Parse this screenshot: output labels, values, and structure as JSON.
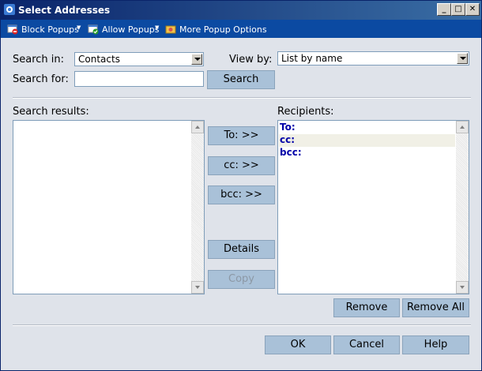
{
  "window": {
    "title": "Select Addresses",
    "minimize": "_",
    "maximize": "□",
    "close": "✕"
  },
  "toolbar": {
    "block_popups": "Block Popups",
    "allow_popups": "Allow Popups",
    "more_options": "More Popup Options"
  },
  "search": {
    "search_in_label": "Search in:",
    "search_in_value": "Contacts",
    "view_by_label": "View by:",
    "view_by_value": "List by name",
    "search_for_label": "Search for:",
    "search_for_value": "",
    "search_button": "Search"
  },
  "results": {
    "label": "Search results:"
  },
  "recipients": {
    "label": "Recipients:",
    "rows": [
      "To:",
      "cc:",
      "bcc:"
    ]
  },
  "middle_buttons": {
    "to": "To: >>",
    "cc": "cc: >>",
    "bcc": "bcc: >>",
    "details": "Details",
    "copy": "Copy"
  },
  "recipient_buttons": {
    "remove": "Remove",
    "remove_all": "Remove All"
  },
  "footer": {
    "ok": "OK",
    "cancel": "Cancel",
    "help": "Help"
  },
  "colors": {
    "title_start": "#0a246a",
    "title_end": "#3a6ea5",
    "toolbar": "#0b4aa2",
    "button": "#a9c1d8",
    "background": "#dfe3ea",
    "recipient_text": "#0000a8"
  }
}
